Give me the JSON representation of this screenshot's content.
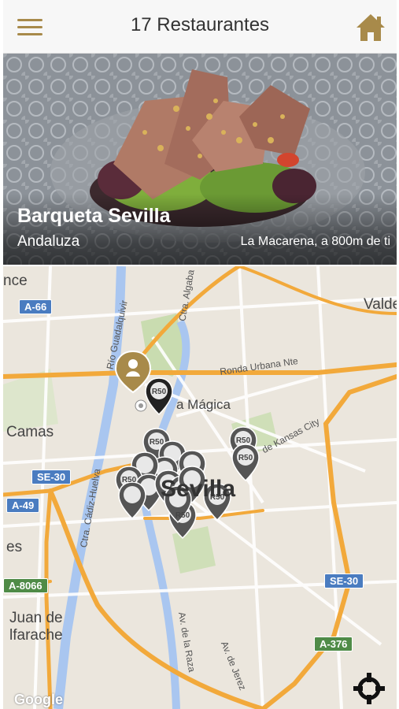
{
  "header": {
    "title": "17 Restaurantes",
    "menu_icon": "menu-icon",
    "home_icon": "home-icon",
    "accent_color": "#a88a4a"
  },
  "featured": {
    "name": "Barqueta Sevilla",
    "cuisine": "Andaluza",
    "location": "La Macarena, a 800m de ti"
  },
  "map": {
    "labels": {
      "city": "Sevilla",
      "camas": "Camas",
      "juan": "Juan de",
      "alfarache": "lfarache",
      "valde": "Valde",
      "ance": "nce",
      "es": "es",
      "magica": "a Mágica"
    },
    "roads": {
      "a66": "A-66",
      "se30_left": "SE-30",
      "a49": "A-49",
      "a8066": "A-8066",
      "se30_right": "SE-30",
      "a376": "A-376",
      "ronda": "Ronda Urbana Nte",
      "kansas": "de Kansas City",
      "guadalquivir": "Río Guadalquivir",
      "cadiz": "Ctra. Cádiz-Huelva",
      "algaba": "Ctra. Algaba",
      "raza": "Av. de la Raza",
      "jerez": "Av. de Jerez"
    },
    "pin_label": "R50",
    "attribution": "Google",
    "locate_icon": "crosshair-icon",
    "user_location_icon": "user-location-pin-icon"
  }
}
